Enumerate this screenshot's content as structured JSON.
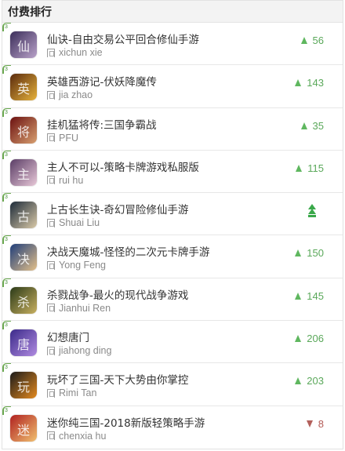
{
  "header": {
    "title": "付费排行"
  },
  "rows": [
    {
      "rank": "3",
      "title": "仙诀-自由交易公平回合修仙手游",
      "developer": "xichun xie",
      "trend": "up",
      "change": "56",
      "icon": {
        "name": "xianjue-app-icon",
        "colors": [
          "#3b2e5a",
          "#b9a2c9"
        ],
        "glyph": "仙"
      }
    },
    {
      "rank": "3",
      "title": "英雄西游记-伏妖降魔传",
      "developer": "jia zhao",
      "trend": "up",
      "change": "143",
      "icon": {
        "name": "yingxiong-xiyouji-app-icon",
        "colors": [
          "#5a2a0d",
          "#e6b23c"
        ],
        "glyph": "英"
      }
    },
    {
      "rank": "3",
      "title": "挂机猛将传:三国争霸战",
      "developer": "PFU",
      "trend": "up",
      "change": "35",
      "icon": {
        "name": "guaji-mengjiang-app-icon",
        "colors": [
          "#6b1010",
          "#d8a070"
        ],
        "glyph": "将"
      }
    },
    {
      "rank": "3",
      "title": "主人不可以-策略卡牌游戏私服版",
      "developer": "rui hu",
      "trend": "up",
      "change": "115",
      "icon": {
        "name": "zhuren-bukeyi-app-icon",
        "colors": [
          "#5a3d66",
          "#e8c8d8"
        ],
        "glyph": "主"
      }
    },
    {
      "rank": "3",
      "title": "上古长生诀-奇幻冒险修仙手游",
      "developer": "Shuai Liu",
      "trend": "new",
      "change": "",
      "icon": {
        "name": "shanggu-changsheng-app-icon",
        "colors": [
          "#1d2b3a",
          "#d9c9a8"
        ],
        "glyph": "古"
      }
    },
    {
      "rank": "3",
      "title": "决战天魔城-怪怪的二次元卡牌手游",
      "developer": "Yong Feng",
      "trend": "up",
      "change": "150",
      "icon": {
        "name": "juezhan-tianmocheng-app-icon",
        "colors": [
          "#1f3e7a",
          "#e3c08a"
        ],
        "glyph": "决"
      }
    },
    {
      "rank": "3",
      "title": "杀戮战争-最火的现代战争游戏",
      "developer": "Jianhui Ren",
      "trend": "up",
      "change": "145",
      "icon": {
        "name": "shalu-zhanzheng-app-icon",
        "colors": [
          "#2a3a18",
          "#c8b060"
        ],
        "glyph": "杀"
      }
    },
    {
      "rank": "3",
      "title": "幻想唐门",
      "developer": "jiahong ding",
      "trend": "up",
      "change": "206",
      "icon": {
        "name": "huanxiang-tangmen-app-icon",
        "colors": [
          "#3b2a8a",
          "#b08be0"
        ],
        "glyph": "唐"
      }
    },
    {
      "rank": "3",
      "title": "玩坏了三国-天下大势由你掌控",
      "developer": "Rimi Tan",
      "trend": "up",
      "change": "203",
      "icon": {
        "name": "wanhuai-sanguo-app-icon",
        "colors": [
          "#1a1a1a",
          "#e38a1f"
        ],
        "glyph": "玩"
      }
    },
    {
      "rank": "3",
      "title": "迷你纯三国-2018新版轻策略手游",
      "developer": "chenxia hu",
      "trend": "down",
      "change": "8",
      "icon": {
        "name": "mini-sanguo-app-icon",
        "colors": [
          "#b02020",
          "#f0c070"
        ],
        "glyph": "迷"
      }
    }
  ]
}
